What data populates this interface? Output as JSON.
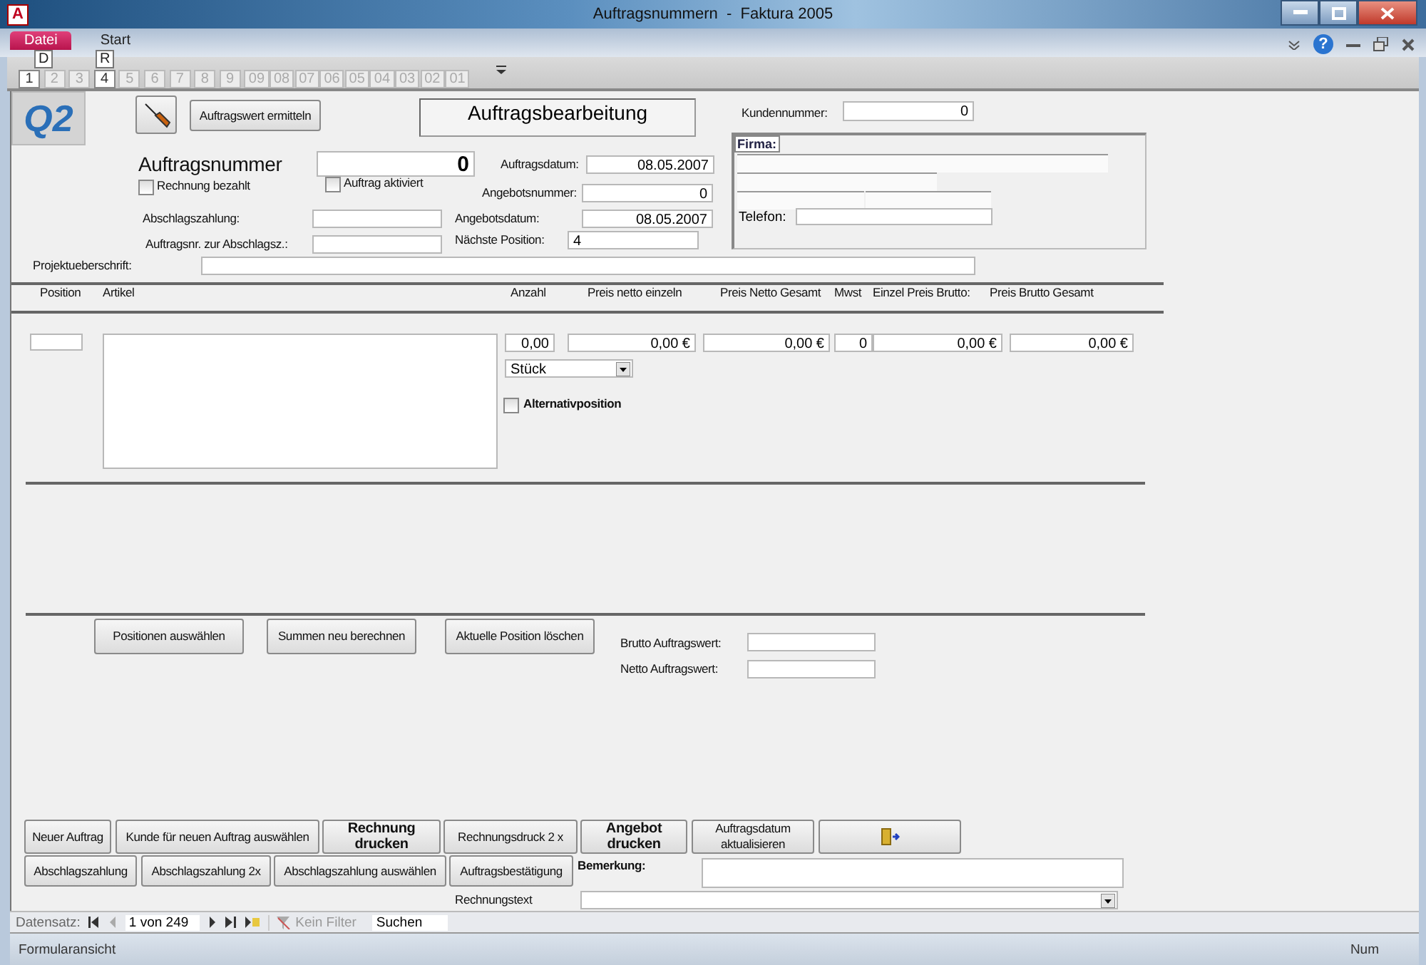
{
  "window": {
    "title": "Auftragsnummern  -  Faktura 2005",
    "app_icon": "A",
    "help": "?"
  },
  "ribbon_tabs": [
    {
      "label": "Datei",
      "selected": true,
      "key_tip": "D"
    },
    {
      "label": "Start",
      "selected": false,
      "key_tip": "R"
    }
  ],
  "quick_access": [
    {
      "key_tip": "1",
      "disabled": false
    },
    {
      "key_tip": "2",
      "disabled": true
    },
    {
      "key_tip": "3",
      "disabled": true
    },
    {
      "key_tip": "4",
      "disabled": false
    },
    {
      "key_tip": "5",
      "disabled": true
    },
    {
      "key_tip": "6",
      "disabled": true
    },
    {
      "key_tip": "7",
      "disabled": true
    },
    {
      "key_tip": "8",
      "disabled": true
    },
    {
      "key_tip": "9",
      "disabled": true
    },
    {
      "key_tip": "09",
      "disabled": true
    },
    {
      "key_tip": "08",
      "disabled": true
    },
    {
      "key_tip": "07",
      "disabled": true
    },
    {
      "key_tip": "06",
      "disabled": true
    },
    {
      "key_tip": "05",
      "disabled": true
    },
    {
      "key_tip": "04",
      "disabled": true
    },
    {
      "key_tip": "03",
      "disabled": true
    },
    {
      "key_tip": "02",
      "disabled": true
    },
    {
      "key_tip": "01",
      "disabled": true
    }
  ],
  "header": {
    "logo": "Q2",
    "button": "Auftragswert ermitteln",
    "title": "Auftragsbearbeitung"
  },
  "fields": [
    {
      "label": "Kundennummer:",
      "value": "0"
    },
    {
      "label": "Auftragsnummer",
      "value": "0"
    },
    {
      "label": "Auftragsdatum:",
      "value": "08.05.2007"
    },
    {
      "label": "Angebotsnummer:",
      "value": "0"
    },
    {
      "label": "Abschlagszahlung:"
    },
    {
      "label": "Angebotsdatum:",
      "value": "08.05.2007"
    },
    {
      "label": "Auftragsnr. zur Abschlagsz.:"
    },
    {
      "label": "Nächste Position:",
      "value": "4"
    },
    {
      "label": "Projektueberschrift:"
    }
  ],
  "checkboxes": [
    {
      "label": "Rechnung bezahlt",
      "checked": false
    },
    {
      "label": "Auftrag aktiviert",
      "checked": false
    }
  ],
  "firma": {
    "label": "Firma:",
    "phone_label": "Telefon:"
  },
  "columns": [
    "Position",
    "Artikel",
    "Anzahl",
    "Preis netto einzeln",
    "Preis Netto Gesamt",
    "Mwst",
    "Einzel Preis Brutto:",
    "Preis Brutto Gesamt"
  ],
  "position_row": {
    "anzahl": "0,00",
    "preis_netto_einzeln": "0,00 €",
    "preis_netto_gesamt": "0,00 €",
    "mwst": "0",
    "einzel_preis_brutto": "0,00 €",
    "preis_brutto_gesamt": "0,00 €",
    "unit": "Stück",
    "alternative": {
      "label": "Alternativposition",
      "checked": false
    }
  },
  "position_buttons": [
    "Positionen auswählen",
    "Summen neu berechnen",
    "Aktuelle Position löschen"
  ],
  "totals": [
    {
      "label": "Brutto Auftragswert:"
    },
    {
      "label": "Netto Auftragswert:"
    }
  ],
  "bottom_buttons": [
    [
      {
        "kind": "text",
        "label": "Neuer Auftrag",
        "bold": false
      },
      {
        "kind": "text",
        "label": "Kunde für neuen Auftrag auswählen",
        "bold": false
      },
      {
        "kind": "text",
        "label": "Rechnung drucken",
        "bold": true
      },
      {
        "kind": "text",
        "label": "Rechnungsdruck 2 x",
        "bold": false
      },
      {
        "kind": "text",
        "label": "Angebot drucken",
        "bold": true
      },
      {
        "kind": "text",
        "label": "Auftragsdatum aktualisieren",
        "bold": false
      },
      {
        "kind": "exit"
      }
    ],
    [
      {
        "kind": "text",
        "label": "Abschlagszahlung",
        "bold": false
      },
      {
        "kind": "text",
        "label": "Abschlagszahlung 2x",
        "bold": false
      },
      {
        "kind": "text",
        "label": "Abschlagszahlung auswählen",
        "bold": false
      },
      {
        "kind": "text",
        "label": "Auftragsbestätigung",
        "bold": false
      }
    ]
  ],
  "remark": {
    "label": "Bemerkung:"
  },
  "invoice_text": {
    "label": "Rechnungstext"
  },
  "navigation": {
    "label": "Datensatz:",
    "record": "1 von 249",
    "filter": "Kein Filter",
    "search": "Suchen"
  },
  "status_bar": {
    "view": "Formularansicht",
    "num": "Num"
  }
}
